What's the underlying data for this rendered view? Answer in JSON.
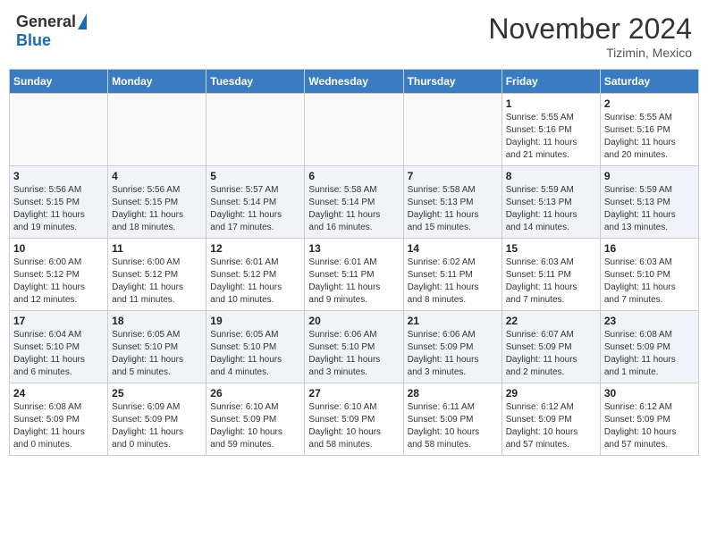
{
  "header": {
    "logo_general": "General",
    "logo_blue": "Blue",
    "month": "November 2024",
    "location": "Tizimin, Mexico"
  },
  "days_of_week": [
    "Sunday",
    "Monday",
    "Tuesday",
    "Wednesday",
    "Thursday",
    "Friday",
    "Saturday"
  ],
  "weeks": [
    [
      {
        "day": "",
        "info": ""
      },
      {
        "day": "",
        "info": ""
      },
      {
        "day": "",
        "info": ""
      },
      {
        "day": "",
        "info": ""
      },
      {
        "day": "",
        "info": ""
      },
      {
        "day": "1",
        "info": "Sunrise: 5:55 AM\nSunset: 5:16 PM\nDaylight: 11 hours\nand 21 minutes."
      },
      {
        "day": "2",
        "info": "Sunrise: 5:55 AM\nSunset: 5:16 PM\nDaylight: 11 hours\nand 20 minutes."
      }
    ],
    [
      {
        "day": "3",
        "info": "Sunrise: 5:56 AM\nSunset: 5:15 PM\nDaylight: 11 hours\nand 19 minutes."
      },
      {
        "day": "4",
        "info": "Sunrise: 5:56 AM\nSunset: 5:15 PM\nDaylight: 11 hours\nand 18 minutes."
      },
      {
        "day": "5",
        "info": "Sunrise: 5:57 AM\nSunset: 5:14 PM\nDaylight: 11 hours\nand 17 minutes."
      },
      {
        "day": "6",
        "info": "Sunrise: 5:58 AM\nSunset: 5:14 PM\nDaylight: 11 hours\nand 16 minutes."
      },
      {
        "day": "7",
        "info": "Sunrise: 5:58 AM\nSunset: 5:13 PM\nDaylight: 11 hours\nand 15 minutes."
      },
      {
        "day": "8",
        "info": "Sunrise: 5:59 AM\nSunset: 5:13 PM\nDaylight: 11 hours\nand 14 minutes."
      },
      {
        "day": "9",
        "info": "Sunrise: 5:59 AM\nSunset: 5:13 PM\nDaylight: 11 hours\nand 13 minutes."
      }
    ],
    [
      {
        "day": "10",
        "info": "Sunrise: 6:00 AM\nSunset: 5:12 PM\nDaylight: 11 hours\nand 12 minutes."
      },
      {
        "day": "11",
        "info": "Sunrise: 6:00 AM\nSunset: 5:12 PM\nDaylight: 11 hours\nand 11 minutes."
      },
      {
        "day": "12",
        "info": "Sunrise: 6:01 AM\nSunset: 5:12 PM\nDaylight: 11 hours\nand 10 minutes."
      },
      {
        "day": "13",
        "info": "Sunrise: 6:01 AM\nSunset: 5:11 PM\nDaylight: 11 hours\nand 9 minutes."
      },
      {
        "day": "14",
        "info": "Sunrise: 6:02 AM\nSunset: 5:11 PM\nDaylight: 11 hours\nand 8 minutes."
      },
      {
        "day": "15",
        "info": "Sunrise: 6:03 AM\nSunset: 5:11 PM\nDaylight: 11 hours\nand 7 minutes."
      },
      {
        "day": "16",
        "info": "Sunrise: 6:03 AM\nSunset: 5:10 PM\nDaylight: 11 hours\nand 7 minutes."
      }
    ],
    [
      {
        "day": "17",
        "info": "Sunrise: 6:04 AM\nSunset: 5:10 PM\nDaylight: 11 hours\nand 6 minutes."
      },
      {
        "day": "18",
        "info": "Sunrise: 6:05 AM\nSunset: 5:10 PM\nDaylight: 11 hours\nand 5 minutes."
      },
      {
        "day": "19",
        "info": "Sunrise: 6:05 AM\nSunset: 5:10 PM\nDaylight: 11 hours\nand 4 minutes."
      },
      {
        "day": "20",
        "info": "Sunrise: 6:06 AM\nSunset: 5:10 PM\nDaylight: 11 hours\nand 3 minutes."
      },
      {
        "day": "21",
        "info": "Sunrise: 6:06 AM\nSunset: 5:09 PM\nDaylight: 11 hours\nand 3 minutes."
      },
      {
        "day": "22",
        "info": "Sunrise: 6:07 AM\nSunset: 5:09 PM\nDaylight: 11 hours\nand 2 minutes."
      },
      {
        "day": "23",
        "info": "Sunrise: 6:08 AM\nSunset: 5:09 PM\nDaylight: 11 hours\nand 1 minute."
      }
    ],
    [
      {
        "day": "24",
        "info": "Sunrise: 6:08 AM\nSunset: 5:09 PM\nDaylight: 11 hours\nand 0 minutes."
      },
      {
        "day": "25",
        "info": "Sunrise: 6:09 AM\nSunset: 5:09 PM\nDaylight: 11 hours\nand 0 minutes."
      },
      {
        "day": "26",
        "info": "Sunrise: 6:10 AM\nSunset: 5:09 PM\nDaylight: 10 hours\nand 59 minutes."
      },
      {
        "day": "27",
        "info": "Sunrise: 6:10 AM\nSunset: 5:09 PM\nDaylight: 10 hours\nand 58 minutes."
      },
      {
        "day": "28",
        "info": "Sunrise: 6:11 AM\nSunset: 5:09 PM\nDaylight: 10 hours\nand 58 minutes."
      },
      {
        "day": "29",
        "info": "Sunrise: 6:12 AM\nSunset: 5:09 PM\nDaylight: 10 hours\nand 57 minutes."
      },
      {
        "day": "30",
        "info": "Sunrise: 6:12 AM\nSunset: 5:09 PM\nDaylight: 10 hours\nand 57 minutes."
      }
    ]
  ]
}
